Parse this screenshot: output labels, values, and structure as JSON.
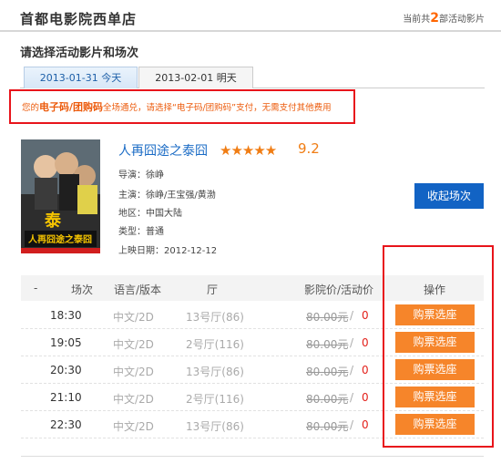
{
  "header": {
    "cinema_name": "首都电影院西单店",
    "count_prefix": "当前共",
    "count": "2",
    "count_suffix": "部活动影片"
  },
  "choose_title": "请选择活动影片和场次",
  "tabs": [
    {
      "label": "2013-01-31 今天",
      "active": true
    },
    {
      "label": "2013-02-01 明天",
      "active": false
    }
  ],
  "notice": {
    "prefix": "您的",
    "highlight": "电子码/团购码",
    "text": "全场通兑，请选择“电子码/团购码”支付，无需支付其他费用"
  },
  "movie": {
    "title": "人再囧途之泰囧",
    "stars": "★★★★★",
    "score": "9.2",
    "director_label": "导演：",
    "director": "徐峥",
    "cast_label": "主演：",
    "cast": "徐峥/王宝强/黄渤",
    "region_label": "地区：",
    "region": "中国大陆",
    "type_label": "类型：",
    "type": "普通",
    "release_label": "上映日期：",
    "release": "2012-12-12",
    "collapse_label": "收起场次"
  },
  "poster": {
    "title_text": "人再囧途之泰囧",
    "subtitle": "泰",
    "colors": {
      "background": "#2d2d2d",
      "title": "#f5c400",
      "accent": "#d11e1e"
    }
  },
  "table": {
    "headers": [
      "-",
      "场次",
      "语言/版本",
      "厅",
      "影院价/活动价",
      "操作"
    ],
    "rows": [
      {
        "time": "18:30",
        "lang": "中文/2D",
        "hall": "13号厅(86)",
        "price": "80.00元",
        "slash": "/",
        "act_price": "0",
        "buy": "购票选座"
      },
      {
        "time": "19:05",
        "lang": "中文/2D",
        "hall": "2号厅(116)",
        "price": "80.00元",
        "slash": "/",
        "act_price": "0",
        "buy": "购票选座"
      },
      {
        "time": "20:30",
        "lang": "中文/2D",
        "hall": "13号厅(86)",
        "price": "80.00元",
        "slash": "/",
        "act_price": "0",
        "buy": "购票选座"
      },
      {
        "time": "21:10",
        "lang": "中文/2D",
        "hall": "2号厅(116)",
        "price": "80.00元",
        "slash": "/",
        "act_price": "0",
        "buy": "购票选座"
      },
      {
        "time": "22:30",
        "lang": "中文/2D",
        "hall": "13号厅(86)",
        "price": "80.00元",
        "slash": "/",
        "act_price": "0",
        "buy": "购票选座"
      }
    ]
  },
  "colors": {
    "accent_orange": "#f6852a",
    "link_blue": "#1a6bc5",
    "button_blue": "#1263c4",
    "highlight_red": "#e8141b"
  }
}
